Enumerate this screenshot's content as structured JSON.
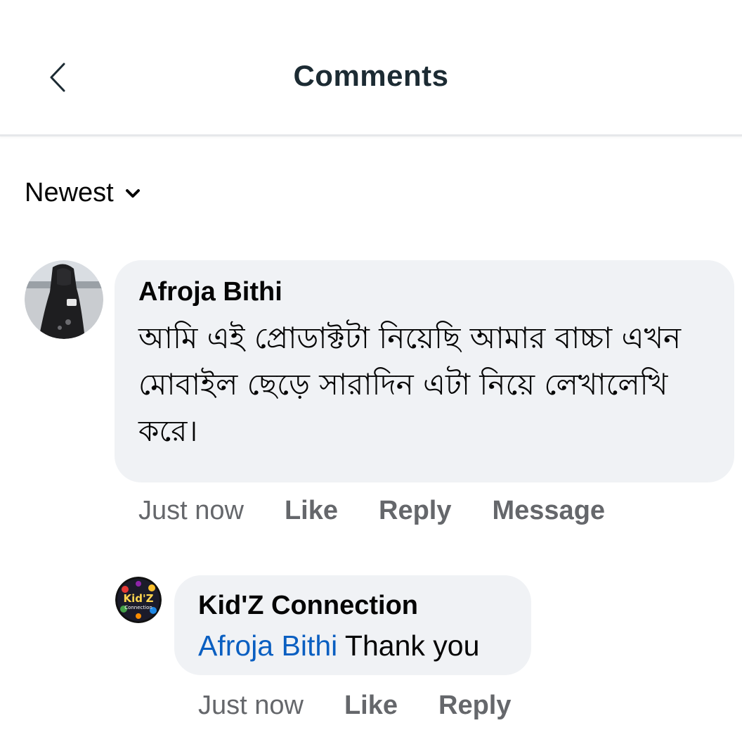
{
  "header": {
    "title": "Comments",
    "back_icon": "chevron-left-icon"
  },
  "sort": {
    "label": "Newest",
    "icon": "chevron-down-icon"
  },
  "comments": [
    {
      "author": "Afroja Bithi",
      "text": "আমি এই প্রোডাক্টটা নিয়েছি আমার বাচ্চা এখন মোবাইল ছেড়ে সারাদিন এটা নিয়ে লেখালেখি করে।",
      "time": "Just now",
      "like_label": "Like",
      "reply_label": "Reply",
      "message_label": "Message"
    }
  ],
  "replies": [
    {
      "author": "Kid'Z Connection",
      "mention": "Afroja Bithi",
      "text": "Thank you",
      "time": "Just now",
      "like_label": "Like",
      "reply_label": "Reply",
      "logo_text": "Kid'Z",
      "logo_subtext": "Connection"
    }
  ],
  "colors": {
    "bubble_bg": "#f0f2f5",
    "mention": "#0a5fc1",
    "secondary_text": "#65676b",
    "title_text": "#1c2b33"
  }
}
